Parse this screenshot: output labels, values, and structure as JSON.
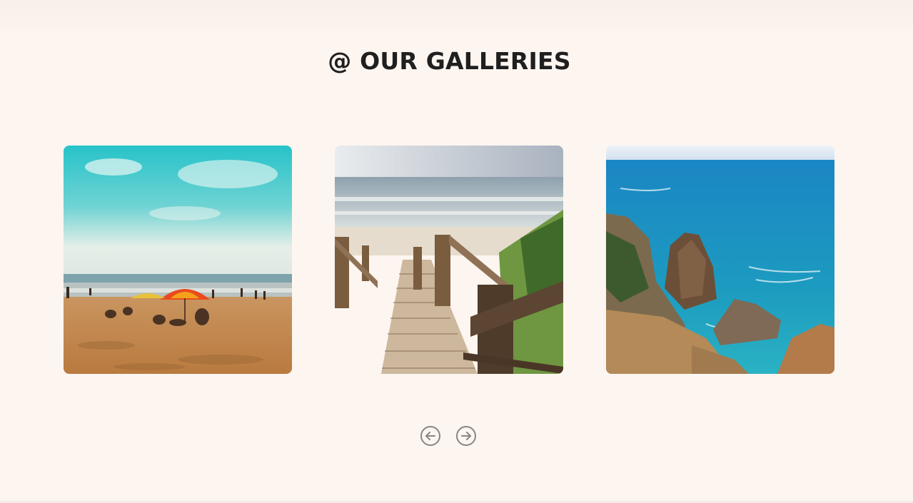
{
  "section": {
    "title": "@ OUR GALLERIES"
  },
  "gallery": {
    "items": [
      {
        "subject": "beach-umbrella-photo"
      },
      {
        "subject": "boardwalk-stairs-photo"
      },
      {
        "subject": "sea-cliffs-photo"
      }
    ]
  },
  "navigation": {
    "prev_icon": "arrow-left-icon",
    "next_icon": "arrow-right-icon"
  },
  "colors": {
    "background": "#fdf5f0",
    "title": "#1f1f1f",
    "nav_stroke": "#8a8583"
  }
}
